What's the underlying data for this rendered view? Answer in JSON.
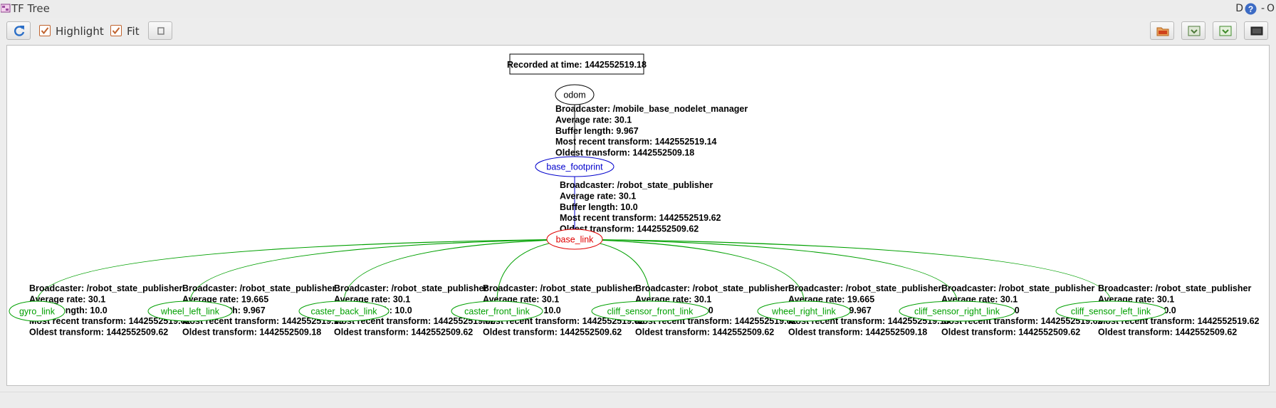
{
  "window": {
    "title": "TF Tree",
    "right_letter": "D",
    "right_help": "?",
    "right_close": "-",
    "right_extra": "O"
  },
  "toolbar": {
    "highlight_label": "Highlight",
    "fit_label": "Fit"
  },
  "graph": {
    "recorded": "Recorded at time: 1442552519.18",
    "nodes": {
      "odom": "odom",
      "base_footprint": "base_footprint",
      "base_link": "base_link"
    },
    "colors": {
      "root": "#000000",
      "footprint": "#0000cc",
      "base": "#e00000",
      "leaf": "#00a000"
    },
    "edge_odom": [
      "Broadcaster: /mobile_base_nodelet_manager",
      "Average rate: 30.1",
      "Buffer length: 9.967",
      "Most recent transform: 1442552519.14",
      "Oldest transform: 1442552509.18"
    ],
    "edge_footprint": [
      "Broadcaster: /robot_state_publisher",
      "Average rate: 30.1",
      "Buffer length: 10.0",
      "Most recent transform: 1442552519.62",
      "Oldest transform: 1442552509.62"
    ],
    "leaves": [
      {
        "name": "gyro_link",
        "info": [
          "Broadcaster: /robot_state_publisher",
          "Average rate: 30.1",
          "Buffer length: 10.0",
          "Most recent transform: 1442552519.62",
          "Oldest transform: 1442552509.62"
        ]
      },
      {
        "name": "wheel_left_link",
        "info": [
          "Broadcaster: /robot_state_publisher",
          "Average rate: 19.665",
          "Buffer length: 9.967",
          "Most recent transform: 1442552519.15",
          "Oldest transform: 1442552509.18"
        ]
      },
      {
        "name": "caster_back_link",
        "info": [
          "Broadcaster: /robot_state_publisher",
          "Average rate: 30.1",
          "Buffer length: 10.0",
          "Most recent transform: 1442552519.62",
          "Oldest transform: 1442552509.62"
        ]
      },
      {
        "name": "caster_front_link",
        "info": [
          "Broadcaster: /robot_state_publisher",
          "Average rate: 30.1",
          "Buffer length: 10.0",
          "Most recent transform: 1442552519.62",
          "Oldest transform: 1442552509.62"
        ]
      },
      {
        "name": "cliff_sensor_front_link",
        "info": [
          "Broadcaster: /robot_state_publisher",
          "Average rate: 30.1",
          "Buffer length: 10.0",
          "Most recent transform: 1442552519.62",
          "Oldest transform: 1442552509.62"
        ]
      },
      {
        "name": "wheel_right_link",
        "info": [
          "Broadcaster: /robot_state_publisher",
          "Average rate: 19.665",
          "Buffer length: 9.967",
          "Most recent transform: 1442552519.15",
          "Oldest transform: 1442552509.18"
        ]
      },
      {
        "name": "cliff_sensor_right_link",
        "info": [
          "Broadcaster: /robot_state_publisher",
          "Average rate: 30.1",
          "Buffer length: 10.0",
          "Most recent transform: 1442552519.62",
          "Oldest transform: 1442552509.62"
        ]
      },
      {
        "name": "cliff_sensor_left_link",
        "info": [
          "Broadcaster: /robot_state_publisher",
          "Average rate: 30.1",
          "Buffer length: 10.0",
          "Most recent transform: 1442552519.62",
          "Oldest transform: 1442552509.62"
        ]
      }
    ]
  }
}
